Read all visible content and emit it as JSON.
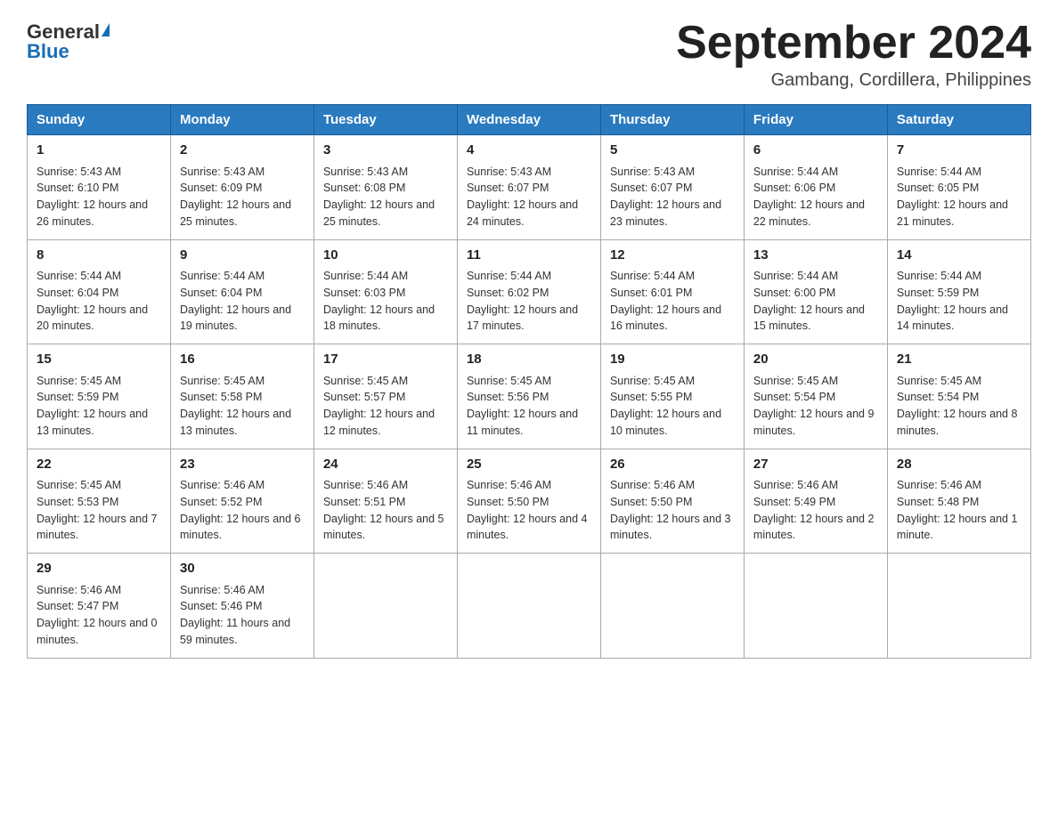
{
  "logo": {
    "general": "General",
    "blue": "Blue"
  },
  "title": "September 2024",
  "location": "Gambang, Cordillera, Philippines",
  "days_of_week": [
    "Sunday",
    "Monday",
    "Tuesday",
    "Wednesday",
    "Thursday",
    "Friday",
    "Saturday"
  ],
  "weeks": [
    [
      {
        "day": "1",
        "sunrise": "5:43 AM",
        "sunset": "6:10 PM",
        "daylight": "12 hours and 26 minutes."
      },
      {
        "day": "2",
        "sunrise": "5:43 AM",
        "sunset": "6:09 PM",
        "daylight": "12 hours and 25 minutes."
      },
      {
        "day": "3",
        "sunrise": "5:43 AM",
        "sunset": "6:08 PM",
        "daylight": "12 hours and 25 minutes."
      },
      {
        "day": "4",
        "sunrise": "5:43 AM",
        "sunset": "6:07 PM",
        "daylight": "12 hours and 24 minutes."
      },
      {
        "day": "5",
        "sunrise": "5:43 AM",
        "sunset": "6:07 PM",
        "daylight": "12 hours and 23 minutes."
      },
      {
        "day": "6",
        "sunrise": "5:44 AM",
        "sunset": "6:06 PM",
        "daylight": "12 hours and 22 minutes."
      },
      {
        "day": "7",
        "sunrise": "5:44 AM",
        "sunset": "6:05 PM",
        "daylight": "12 hours and 21 minutes."
      }
    ],
    [
      {
        "day": "8",
        "sunrise": "5:44 AM",
        "sunset": "6:04 PM",
        "daylight": "12 hours and 20 minutes."
      },
      {
        "day": "9",
        "sunrise": "5:44 AM",
        "sunset": "6:04 PM",
        "daylight": "12 hours and 19 minutes."
      },
      {
        "day": "10",
        "sunrise": "5:44 AM",
        "sunset": "6:03 PM",
        "daylight": "12 hours and 18 minutes."
      },
      {
        "day": "11",
        "sunrise": "5:44 AM",
        "sunset": "6:02 PM",
        "daylight": "12 hours and 17 minutes."
      },
      {
        "day": "12",
        "sunrise": "5:44 AM",
        "sunset": "6:01 PM",
        "daylight": "12 hours and 16 minutes."
      },
      {
        "day": "13",
        "sunrise": "5:44 AM",
        "sunset": "6:00 PM",
        "daylight": "12 hours and 15 minutes."
      },
      {
        "day": "14",
        "sunrise": "5:44 AM",
        "sunset": "5:59 PM",
        "daylight": "12 hours and 14 minutes."
      }
    ],
    [
      {
        "day": "15",
        "sunrise": "5:45 AM",
        "sunset": "5:59 PM",
        "daylight": "12 hours and 13 minutes."
      },
      {
        "day": "16",
        "sunrise": "5:45 AM",
        "sunset": "5:58 PM",
        "daylight": "12 hours and 13 minutes."
      },
      {
        "day": "17",
        "sunrise": "5:45 AM",
        "sunset": "5:57 PM",
        "daylight": "12 hours and 12 minutes."
      },
      {
        "day": "18",
        "sunrise": "5:45 AM",
        "sunset": "5:56 PM",
        "daylight": "12 hours and 11 minutes."
      },
      {
        "day": "19",
        "sunrise": "5:45 AM",
        "sunset": "5:55 PM",
        "daylight": "12 hours and 10 minutes."
      },
      {
        "day": "20",
        "sunrise": "5:45 AM",
        "sunset": "5:54 PM",
        "daylight": "12 hours and 9 minutes."
      },
      {
        "day": "21",
        "sunrise": "5:45 AM",
        "sunset": "5:54 PM",
        "daylight": "12 hours and 8 minutes."
      }
    ],
    [
      {
        "day": "22",
        "sunrise": "5:45 AM",
        "sunset": "5:53 PM",
        "daylight": "12 hours and 7 minutes."
      },
      {
        "day": "23",
        "sunrise": "5:46 AM",
        "sunset": "5:52 PM",
        "daylight": "12 hours and 6 minutes."
      },
      {
        "day": "24",
        "sunrise": "5:46 AM",
        "sunset": "5:51 PM",
        "daylight": "12 hours and 5 minutes."
      },
      {
        "day": "25",
        "sunrise": "5:46 AM",
        "sunset": "5:50 PM",
        "daylight": "12 hours and 4 minutes."
      },
      {
        "day": "26",
        "sunrise": "5:46 AM",
        "sunset": "5:50 PM",
        "daylight": "12 hours and 3 minutes."
      },
      {
        "day": "27",
        "sunrise": "5:46 AM",
        "sunset": "5:49 PM",
        "daylight": "12 hours and 2 minutes."
      },
      {
        "day": "28",
        "sunrise": "5:46 AM",
        "sunset": "5:48 PM",
        "daylight": "12 hours and 1 minute."
      }
    ],
    [
      {
        "day": "29",
        "sunrise": "5:46 AM",
        "sunset": "5:47 PM",
        "daylight": "12 hours and 0 minutes."
      },
      {
        "day": "30",
        "sunrise": "5:46 AM",
        "sunset": "5:46 PM",
        "daylight": "11 hours and 59 minutes."
      },
      null,
      null,
      null,
      null,
      null
    ]
  ],
  "labels": {
    "sunrise": "Sunrise:",
    "sunset": "Sunset:",
    "daylight": "Daylight:"
  }
}
